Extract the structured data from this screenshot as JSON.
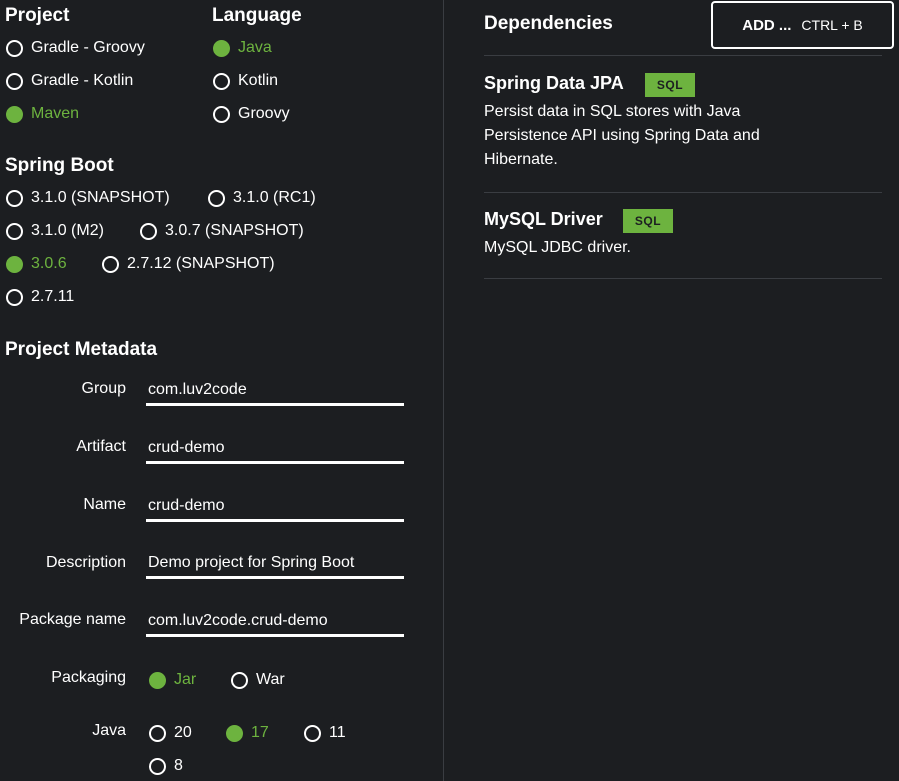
{
  "project": {
    "title": "Project",
    "options": [
      "Gradle - Groovy",
      "Gradle - Kotlin",
      "Maven"
    ],
    "selected": "Maven"
  },
  "language": {
    "title": "Language",
    "options": [
      "Java",
      "Kotlin",
      "Groovy"
    ],
    "selected": "Java"
  },
  "spring_boot": {
    "title": "Spring Boot",
    "options": [
      "3.1.0 (SNAPSHOT)",
      "3.1.0 (RC1)",
      "3.1.0 (M2)",
      "3.0.7 (SNAPSHOT)",
      "3.0.6",
      "2.7.12 (SNAPSHOT)",
      "2.7.11"
    ],
    "selected": "3.0.6"
  },
  "metadata": {
    "title": "Project Metadata",
    "fields": [
      {
        "label": "Group",
        "value": "com.luv2code"
      },
      {
        "label": "Artifact",
        "value": "crud-demo"
      },
      {
        "label": "Name",
        "value": "crud-demo"
      },
      {
        "label": "Description",
        "value": "Demo project for Spring Boot"
      },
      {
        "label": "Package name",
        "value": "com.luv2code.crud-demo"
      }
    ],
    "packaging": {
      "label": "Packaging",
      "options": [
        "Jar",
        "War"
      ],
      "selected": "Jar"
    },
    "java": {
      "label": "Java",
      "options": [
        "20",
        "17",
        "11",
        "8"
      ],
      "selected": "17"
    }
  },
  "dependencies": {
    "title": "Dependencies",
    "add_label": "ADD ...",
    "add_shortcut": "CTRL + B",
    "items": [
      {
        "name": "Spring Data JPA",
        "tag": "SQL",
        "description": "Persist data in SQL stores with Java Persistence API using Spring Data and Hibernate."
      },
      {
        "name": "MySQL Driver",
        "tag": "SQL",
        "description": "MySQL JDBC driver."
      }
    ]
  },
  "colors": {
    "background": "#1c1e21",
    "accent": "#6db33f",
    "text": "#ffffff",
    "divider": "#3a3d42"
  }
}
